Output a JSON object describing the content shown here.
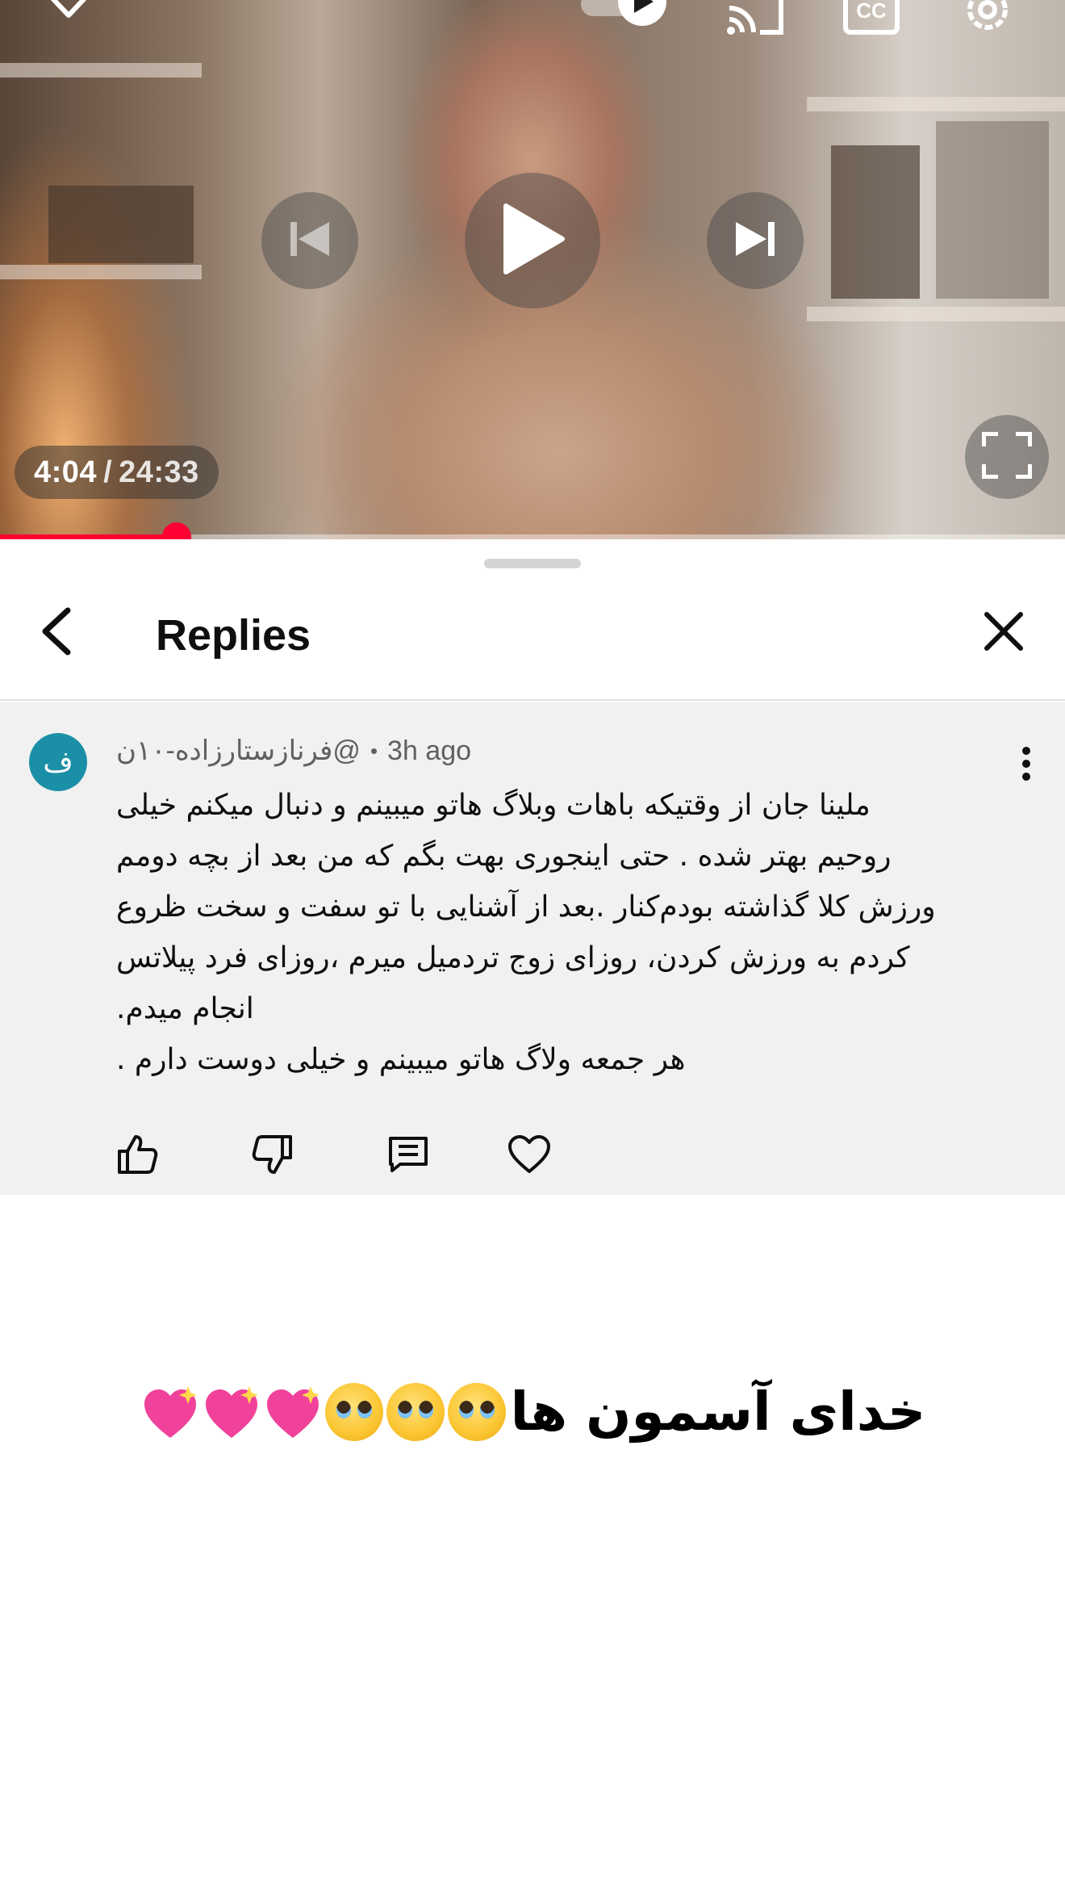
{
  "player": {
    "current_time": "4:04",
    "separator": "/",
    "duration": "24:33",
    "progress_fraction": 0.166,
    "accent_color": "#ff0033"
  },
  "icons": {
    "top_bar": [
      "chevron-down-icon",
      "autoplay-toggle-icon",
      "cast-icon",
      "captions-icon",
      "settings-icon"
    ],
    "controls": [
      "previous-icon",
      "play-icon",
      "next-icon",
      "fullscreen-icon"
    ],
    "sheet": [
      "back-arrow-icon",
      "close-icon"
    ],
    "comment_actions": [
      "like-icon",
      "dislike-icon",
      "reply-icon",
      "heart-icon"
    ]
  },
  "sheet": {
    "title": "Replies"
  },
  "comment": {
    "avatar_letter": "ف",
    "avatar_color": "#1b8fa6",
    "author": "@فرنازستارزاده-۱۰ن",
    "dot": "•",
    "time_ago": "3h ago",
    "lines": [
      "ملینا جان از وقتیکه باهات وبلاگ هاتو میبینم و دنبال میکنم خیلی",
      "روحیم بهتر شده . حتی اینجوری بهت بگم که من بعد از بچه دومم",
      "ورزش کلا گذاشته بودم‌کنار .بعد از آشنایی با تو سفت و سخت ظروع",
      "کردم به ورزش کردن، روزای زوج تردمیل میرم ،روزای  فرد پیلاتس",
      "انجام میدم.",
      "هر جمعه ولاگ هاتو میبینم و خیلی دوست دارم ."
    ]
  },
  "caption": {
    "text": "خدای آسمون ها",
    "emojis": [
      "pleading-face",
      "pleading-face",
      "pleading-face",
      "sparkling-heart",
      "sparkling-heart",
      "sparkling-heart"
    ]
  }
}
